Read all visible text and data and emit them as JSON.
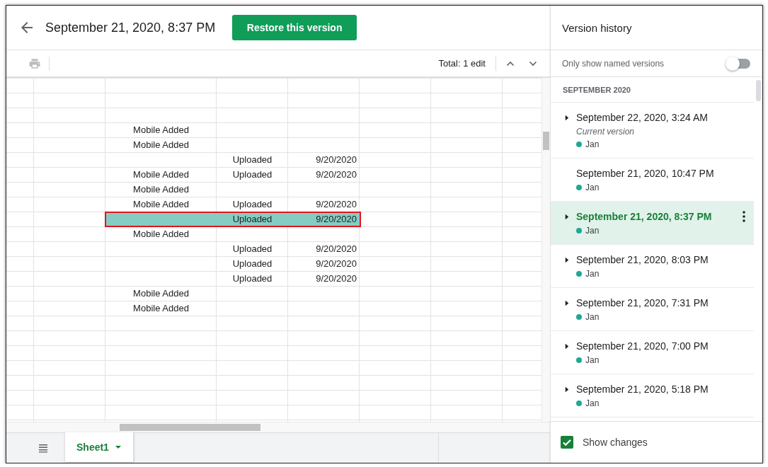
{
  "header": {
    "title": "September 21, 2020, 8:37 PM",
    "restore_button": "Restore this version"
  },
  "toolbar": {
    "total": "Total: 1 edit"
  },
  "sheet": {
    "rows": [
      {
        "changed": false
      },
      {
        "changed": false
      },
      {
        "changed": false
      },
      {
        "changed": false,
        "column_3": "Mobile Added"
      },
      {
        "changed": false,
        "column_3": "Mobile Added"
      },
      {
        "changed": false,
        "column_4": "Uploaded",
        "column_5": "9/20/2020"
      },
      {
        "changed": false,
        "column_3": "Mobile Added",
        "column_4": "Uploaded",
        "column_5": "9/20/2020"
      },
      {
        "changed": false,
        "column_3": "Mobile Added"
      },
      {
        "changed": false,
        "column_3": "Mobile Added",
        "column_4": "Uploaded",
        "column_5": "9/20/2020"
      },
      {
        "changed": true,
        "column_4": "Uploaded",
        "column_5": "9/20/2020"
      },
      {
        "changed": false,
        "column_3": "Mobile Added"
      },
      {
        "changed": false,
        "column_4": "Uploaded",
        "column_5": "9/20/2020"
      },
      {
        "changed": false,
        "column_4": "Uploaded",
        "column_5": "9/20/2020"
      },
      {
        "changed": false,
        "column_4": "Uploaded",
        "column_5": "9/20/2020"
      },
      {
        "changed": false,
        "column_3": "Mobile Added"
      },
      {
        "changed": false,
        "column_3": "Mobile Added"
      }
    ]
  },
  "sheet_tabs": [
    {
      "label": "Sheet1",
      "selected": true
    }
  ],
  "version_history": {
    "title": "Version history",
    "named_only": {
      "label": "Only show named versions",
      "on": false
    },
    "section": "SEPTEMBER 2020",
    "versions": [
      {
        "date": "September 22, 2020, 3:24 AM",
        "expandable": true,
        "selected": false,
        "note": "Current version",
        "editors": [
          {
            "name": "Jan",
            "color": "#1ea896"
          }
        ]
      },
      {
        "date": "September 21, 2020, 10:47 PM",
        "expandable": false,
        "selected": false,
        "editors": [
          {
            "name": "Jan",
            "color": "#1ea896"
          }
        ]
      },
      {
        "date": "September 21, 2020, 8:37 PM",
        "expandable": true,
        "selected": true,
        "editors": [
          {
            "name": "Jan",
            "color": "#1ea896"
          }
        ]
      },
      {
        "date": "September 21, 2020, 8:03 PM",
        "expandable": true,
        "selected": false,
        "editors": [
          {
            "name": "Jan",
            "color": "#1ea896"
          }
        ]
      },
      {
        "date": "September 21, 2020, 7:31 PM",
        "expandable": true,
        "selected": false,
        "editors": [
          {
            "name": "Jan",
            "color": "#1ea896"
          }
        ]
      },
      {
        "date": "September 21, 2020, 7:00 PM",
        "expandable": true,
        "selected": false,
        "editors": [
          {
            "name": "Jan",
            "color": "#1ea896"
          }
        ]
      },
      {
        "date": "September 21, 2020, 5:18 PM",
        "expandable": true,
        "selected": false,
        "editors": [
          {
            "name": "Jan",
            "color": "#1ea896"
          }
        ]
      }
    ],
    "show_changes": {
      "label": "Show changes",
      "checked": true
    }
  }
}
